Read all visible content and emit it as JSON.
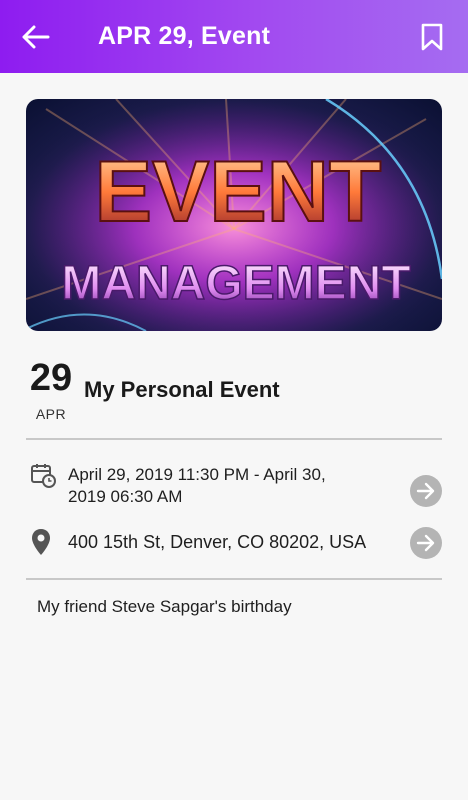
{
  "appbar": {
    "title": "APR 29, Event",
    "back_icon": "arrow-left-icon",
    "bookmark_icon": "bookmark-icon"
  },
  "banner": {
    "line1": "EVENT",
    "line2": "MANAGEMENT"
  },
  "event": {
    "day": "29",
    "month": "APR",
    "name": "My Personal Event",
    "datetime_line1": "April 29, 2019 11:30 PM - April 30,",
    "datetime_line2": "2019 06:30 AM",
    "location": "400 15th St, Denver, CO 80202, USA",
    "description": "My friend Steve Sapgar's birthday"
  },
  "colors": {
    "appbar_start": "#8e1cf0",
    "appbar_end": "#a56cf1",
    "action_circle": "#b4b4b4"
  }
}
